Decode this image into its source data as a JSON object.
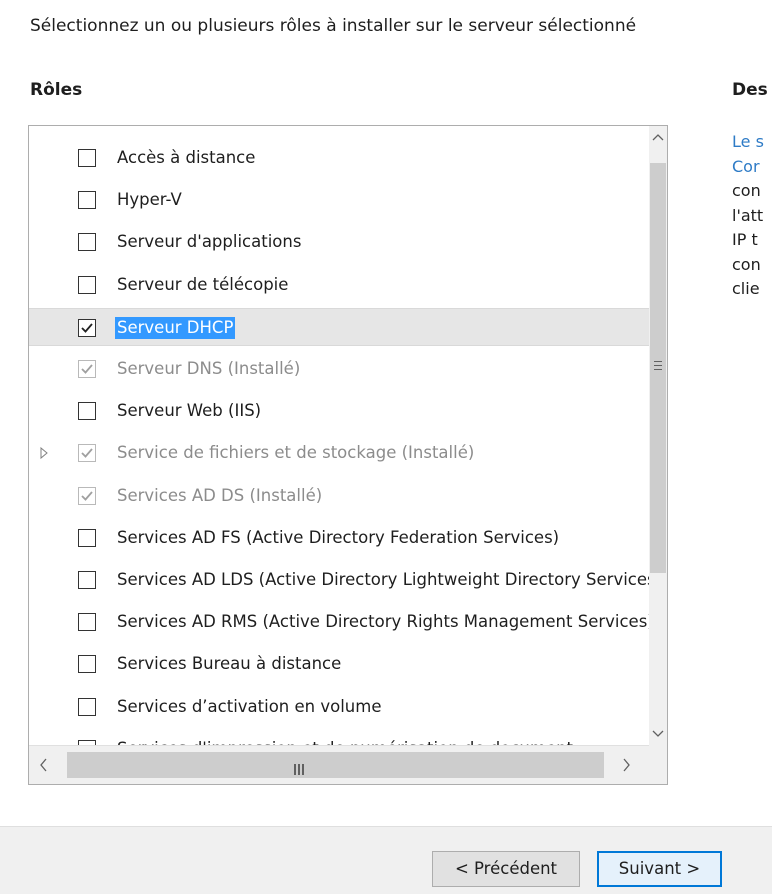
{
  "intro_text": "Sélectionnez un ou plusieurs rôles à installer sur le serveur sélectionné",
  "roles_header": "Rôles",
  "description": {
    "header": "Des",
    "lines": [
      "Le s",
      "Cor",
      "con",
      "l'att",
      "IP t",
      "con",
      "clie"
    ]
  },
  "roles": [
    {
      "label": "Accès à distance",
      "checked": false,
      "disabled": false
    },
    {
      "label": "Hyper-V",
      "checked": false,
      "disabled": false
    },
    {
      "label": "Serveur d'applications",
      "checked": false,
      "disabled": false
    },
    {
      "label": "Serveur de télécopie",
      "checked": false,
      "disabled": false
    },
    {
      "label": "Serveur DHCP",
      "checked": true,
      "disabled": false,
      "selected": true
    },
    {
      "label": "Serveur DNS (Installé)",
      "checked": true,
      "disabled": true
    },
    {
      "label": "Serveur Web (IIS)",
      "checked": false,
      "disabled": false
    },
    {
      "label": "Service de fichiers et de stockage (Installé)",
      "checked": true,
      "disabled": true,
      "expandable": true
    },
    {
      "label": "Services AD DS (Installé)",
      "checked": true,
      "disabled": true
    },
    {
      "label": "Services AD FS (Active Directory Federation Services)",
      "checked": false,
      "disabled": false
    },
    {
      "label": "Services AD LDS (Active Directory Lightweight Directory Services)",
      "checked": false,
      "disabled": false
    },
    {
      "label": "Services AD RMS (Active Directory Rights Management Services)",
      "checked": false,
      "disabled": false
    },
    {
      "label": "Services Bureau à distance",
      "checked": false,
      "disabled": false
    },
    {
      "label": "Services d’activation en volume",
      "checked": false,
      "disabled": false
    },
    {
      "label": "Services d'impression et de numérisation de document",
      "checked": false,
      "disabled": false
    }
  ],
  "buttons": {
    "previous": "< Précédent",
    "next": "Suivant >"
  },
  "colors": {
    "selection": "#3399ff",
    "link_text": "#2e7bc6",
    "primary_border": "#0078d7"
  }
}
